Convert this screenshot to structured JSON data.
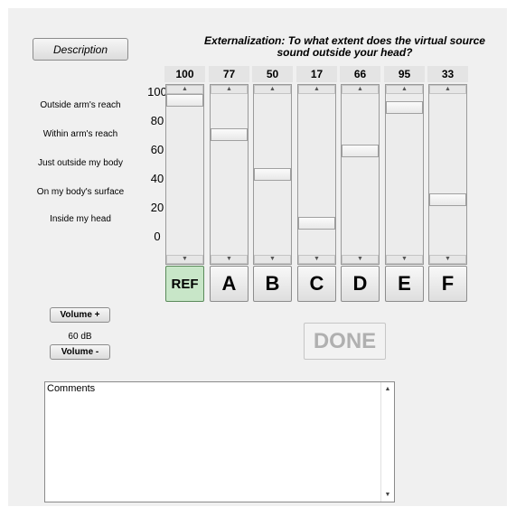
{
  "description_button": "Description",
  "title": "Externalization: To what extent does the virtual source sound outside your head?",
  "scale_labels": [
    "Outside arm's reach",
    "Within arm's reach",
    "Just outside my body",
    "On my body's surface",
    "Inside my head"
  ],
  "scale_ticks": [
    "100",
    "80",
    "60",
    "40",
    "20",
    "0"
  ],
  "sliders": [
    {
      "label": "REF",
      "value": 100,
      "value_text": "100"
    },
    {
      "label": "A",
      "value": 77,
      "value_text": "77"
    },
    {
      "label": "B",
      "value": 50,
      "value_text": "50"
    },
    {
      "label": "C",
      "value": 17,
      "value_text": "17"
    },
    {
      "label": "D",
      "value": 66,
      "value_text": "66"
    },
    {
      "label": "E",
      "value": 95,
      "value_text": "95"
    },
    {
      "label": "F",
      "value": 33,
      "value_text": "33"
    }
  ],
  "slider_range": [
    0,
    100
  ],
  "volume": {
    "up_label": "Volume +",
    "level": "60 dB",
    "down_label": "Volume -"
  },
  "done_button": "DONE",
  "comments": {
    "text": "Comments"
  },
  "colors": {
    "ref_active": "#c8e6c8",
    "done_disabled_text": "#b0b0b0",
    "panel": "#f0f0f0"
  },
  "icons": {
    "up": "triangle-up",
    "down": "triangle-down"
  }
}
